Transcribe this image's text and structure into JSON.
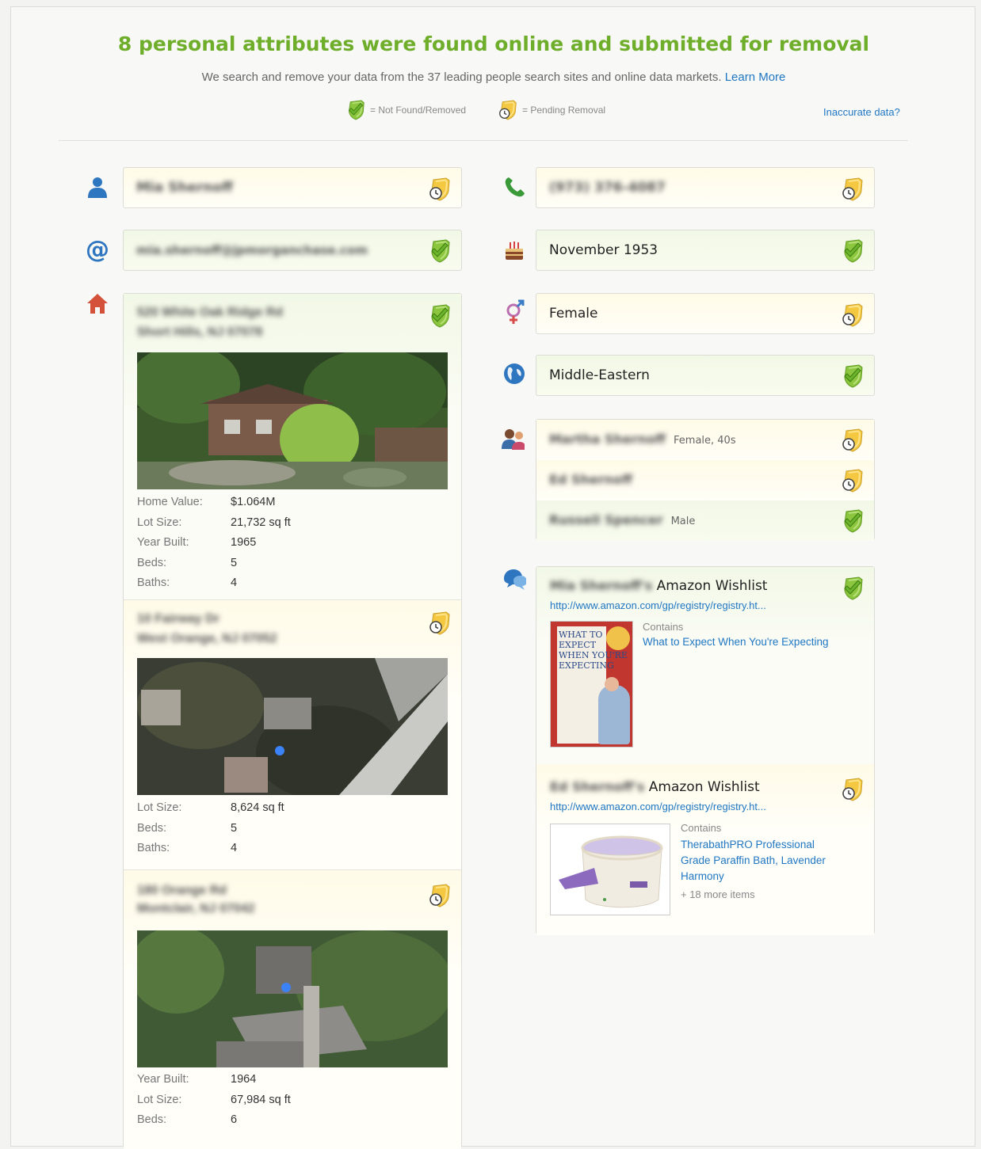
{
  "header": {
    "title": "8 personal attributes were found online and submitted for removal",
    "subtitle": "We search and remove your data from the 37 leading people search sites and online data markets.",
    "learn_more": "Learn More",
    "legend_removed": "= Not Found/Removed",
    "legend_pending": "= Pending Removal",
    "inaccurate": "Inaccurate data?"
  },
  "colors": {
    "accent_green": "#6fae2b",
    "link": "#1f77c4",
    "pending_yellow": "#f5c842",
    "removed_green": "#8cc63e"
  },
  "left": {
    "name": {
      "value": "Mia Shernoff",
      "status": "pending"
    },
    "email": {
      "value": "mia.shernoff@jpmorganchase.com",
      "status": "removed"
    },
    "addresses": [
      {
        "line1": "520 White Oak Ridge Rd",
        "line2": "Short Hills, NJ 07078",
        "status": "removed",
        "stats": [
          [
            "Home Value:",
            "$1.064M"
          ],
          [
            "Lot Size:",
            "21,732 sq ft"
          ],
          [
            "Year Built:",
            "1965"
          ],
          [
            "Beds:",
            "5"
          ],
          [
            "Baths:",
            "4"
          ]
        ]
      },
      {
        "line1": "10 Fairway Dr",
        "line2": "West Orange, NJ 07052",
        "status": "pending",
        "stats": [
          [
            "Lot Size:",
            "8,624 sq ft"
          ],
          [
            "Beds:",
            "5"
          ],
          [
            "Baths:",
            "4"
          ]
        ]
      },
      {
        "line1": "180 Orange Rd",
        "line2": "Montclair, NJ 07042",
        "status": "pending",
        "stats": [
          [
            "Year Built:",
            "1964"
          ],
          [
            "Lot Size:",
            "67,984 sq ft"
          ],
          [
            "Beds:",
            "6"
          ]
        ]
      }
    ]
  },
  "right": {
    "phone": {
      "value": "(973) 376-4087",
      "status": "pending"
    },
    "birth": {
      "value": "November 1953",
      "status": "removed"
    },
    "gender": {
      "value": "Female",
      "status": "pending"
    },
    "ethnicity": {
      "value": "Middle-Eastern",
      "status": "removed"
    },
    "relatives": [
      {
        "name": "Martha Shernoff",
        "detail": "Female, 40s",
        "status": "pending"
      },
      {
        "name": "Ed Shernoff",
        "detail": "",
        "status": "pending"
      },
      {
        "name": "Russell Spencer",
        "detail": "Male",
        "status": "removed"
      }
    ],
    "wishlists": [
      {
        "owner": "Mia Shernoff's",
        "title": "Amazon Wishlist",
        "url": "http://www.amazon.com/gp/registry/registry.ht...",
        "contains": "Contains",
        "item": "What to Expect When You're Expecting",
        "more": "",
        "status": "removed",
        "thumb_text": [
          "WHAT TO",
          "EXPECT",
          "WHEN YOU'RE",
          "EXPECTING"
        ]
      },
      {
        "owner": "Ed Shernoff's",
        "title": "Amazon Wishlist",
        "url": "http://www.amazon.com/gp/registry/registry.ht...",
        "contains": "Contains",
        "item": "TherabathPRO Professional Grade Paraffin Bath, Lavender Harmony",
        "more": "+ 18 more items",
        "status": "pending"
      }
    ]
  }
}
